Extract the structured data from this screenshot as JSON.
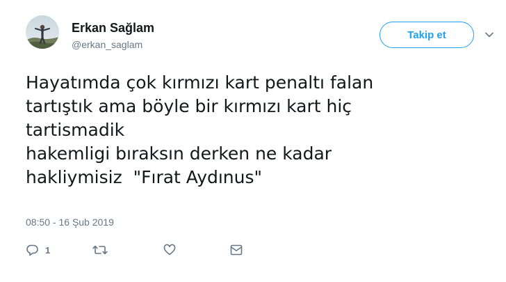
{
  "author": {
    "name": "Erkan Sağlam",
    "handle": "@erkan_saglam"
  },
  "follow_button": {
    "label": "Takip et"
  },
  "tweet": {
    "lines": [
      "Hayatımda çok kırmızı kart penaltı falan",
      "tartıştık ama böyle bir kırmızı kart hiç",
      "tartismadik",
      "hakemligi bıraksın derken ne kadar",
      "hakliymisiz  \"Fırat Aydınus\""
    ],
    "timestamp": "08:50 - 16 Şub 2019"
  },
  "actions": {
    "reply_count": "1",
    "icons": [
      "reply-icon",
      "retweet-icon",
      "heart-icon",
      "message-icon"
    ]
  },
  "colors": {
    "accent": "#1da1f2",
    "text": "#14171a",
    "secondary_text": "#657786"
  }
}
